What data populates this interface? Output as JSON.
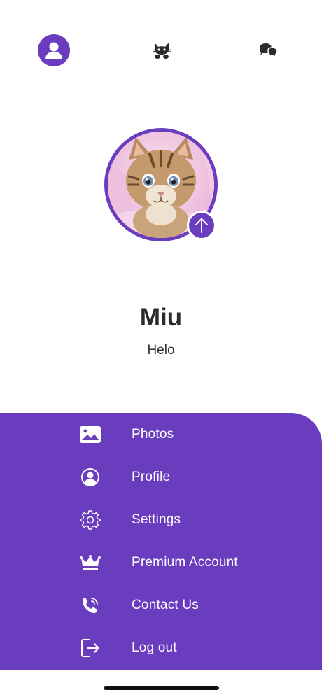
{
  "top_nav": {
    "items": [
      {
        "icon": "user-icon",
        "active": true
      },
      {
        "icon": "cat-icon",
        "active": false
      },
      {
        "icon": "chat-icon",
        "active": false
      }
    ]
  },
  "profile": {
    "name": "Miu",
    "status": "Helo",
    "avatar_icon": "kitten-photo",
    "upload_icon": "arrow-up-icon"
  },
  "menu": {
    "items": [
      {
        "label": "Photos",
        "icon": "image-icon"
      },
      {
        "label": "Profile",
        "icon": "user-circle-icon"
      },
      {
        "label": "Settings",
        "icon": "gear-icon"
      },
      {
        "label": "Premium Account",
        "icon": "crown-icon"
      },
      {
        "label": "Contact Us",
        "icon": "phone-icon"
      },
      {
        "label": "Log out",
        "icon": "logout-icon"
      }
    ]
  },
  "colors": {
    "accent": "#6a3dbf",
    "text_dark": "#2b2b2b",
    "menu_text": "#ffffff"
  }
}
